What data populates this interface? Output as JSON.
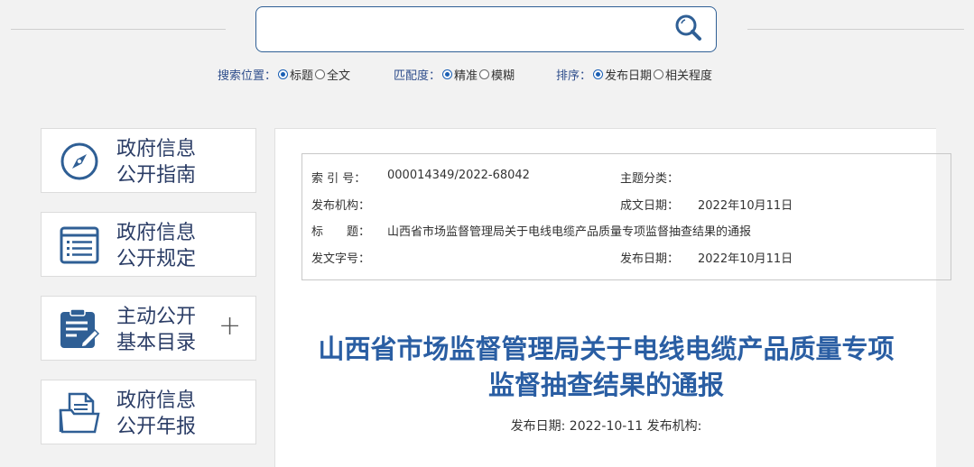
{
  "search": {
    "placeholder": "",
    "position": {
      "label": "搜索位置：",
      "options": [
        {
          "label": "标题",
          "checked": true
        },
        {
          "label": "全文",
          "checked": false
        }
      ]
    },
    "match": {
      "label": "匹配度：",
      "options": [
        {
          "label": "精准",
          "checked": true
        },
        {
          "label": "模糊",
          "checked": false
        }
      ]
    },
    "sort": {
      "label": "排序：",
      "options": [
        {
          "label": "发布日期",
          "checked": true
        },
        {
          "label": "相关程度",
          "checked": false
        }
      ]
    }
  },
  "sidebar": {
    "items": [
      {
        "line1": "政府信息",
        "line2": "公开指南",
        "icon": "compass-icon"
      },
      {
        "line1": "政府信息",
        "line2": "公开规定",
        "icon": "list-icon"
      },
      {
        "line1": "主动公开",
        "line2": "基本目录",
        "icon": "clipboard-edit-icon",
        "plus": "+"
      },
      {
        "line1": "政府信息",
        "line2": "公开年报",
        "icon": "folder-document-icon"
      }
    ]
  },
  "meta": {
    "index_label": "索 引 号：",
    "index_value": "000014349/2022-68042",
    "topic_label": "主题分类：",
    "topic_value": "",
    "publisher_label": "发布机构：",
    "publisher_value": "",
    "written_date_label": "成文日期：",
    "written_date_value": "2022年10月11日",
    "title_label": "标　　题：",
    "title_value": "山西省市场监督管理局关于电线电缆产品质量专项监督抽查结果的通报",
    "doc_number_label": "发文字号：",
    "doc_number_value": "",
    "publish_date_label": "发布日期：",
    "publish_date_value": "2022年10月11日"
  },
  "article": {
    "title_line1": "山西省市场监督管理局关于电线电缆产品质量专项",
    "title_line2": "监督抽查结果的通报",
    "pubinfo": "发布日期: 2022-10-11 发布机构:"
  },
  "colors": {
    "accent": "#2a5ea3",
    "icon": "#2f5f95",
    "background": "#f2f2f2"
  }
}
